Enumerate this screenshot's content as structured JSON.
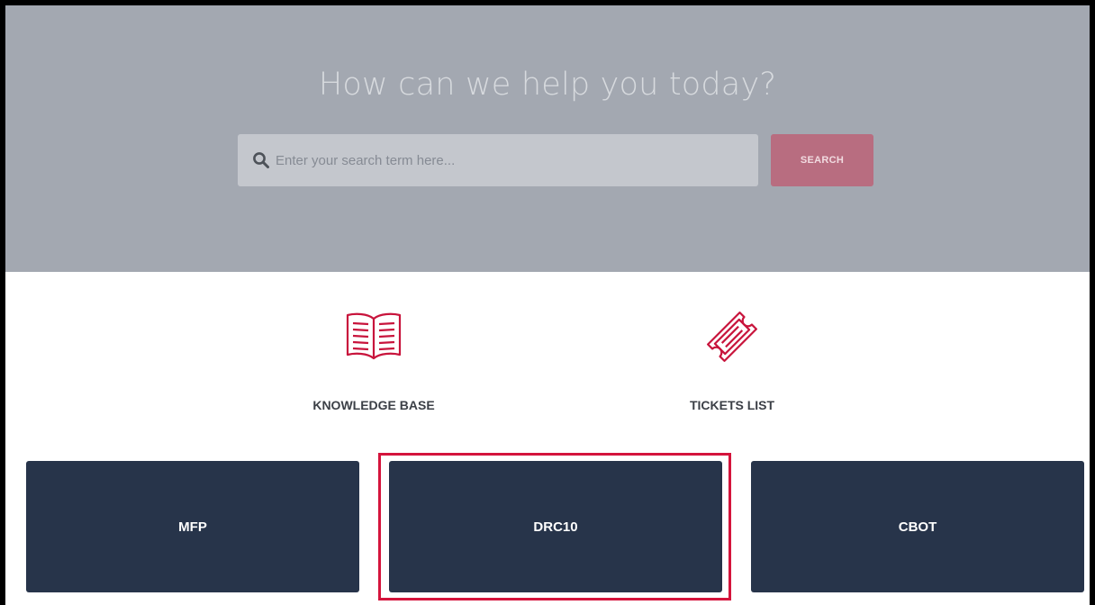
{
  "hero": {
    "title": "How can we help you today?",
    "search_placeholder": "Enter your search term here...",
    "search_button_label": "SEARCH",
    "search_icon": "search-icon"
  },
  "nav_links": [
    {
      "label": "KNOWLEDGE BASE",
      "icon": "open-book-icon"
    },
    {
      "label": "TICKETS LIST",
      "icon": "ticket-icon"
    }
  ],
  "products": [
    {
      "label": "MFP"
    },
    {
      "label": "DRC10",
      "highlighted": true
    },
    {
      "label": "CBOT"
    }
  ],
  "colors": {
    "hero_background": "#a3a8b1",
    "accent": "#c8143c",
    "search_button": "#b86d80",
    "tile_background": "#27344a",
    "highlight": "#d4143c"
  }
}
